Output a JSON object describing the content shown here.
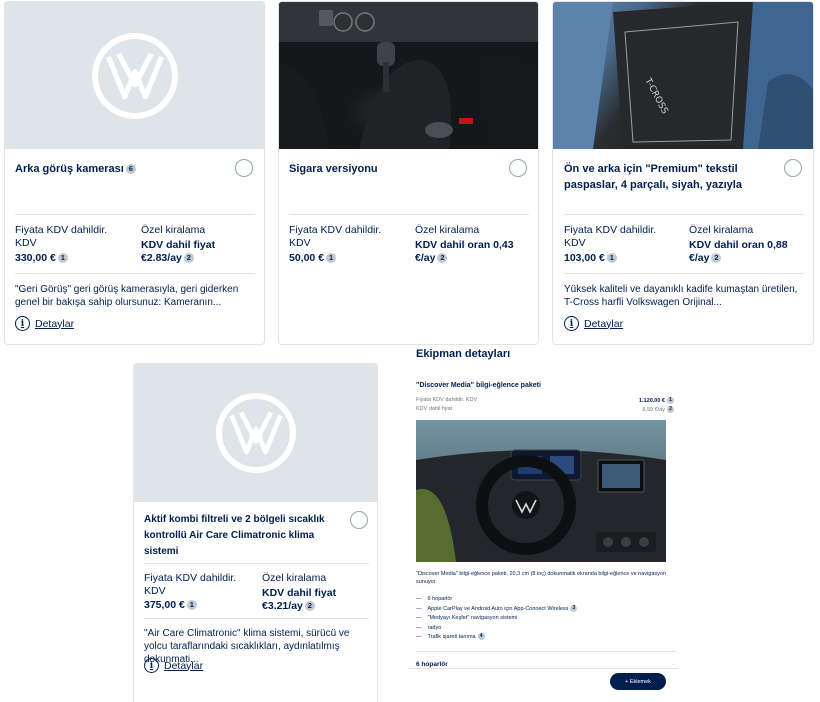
{
  "cards": [
    {
      "title": "Arka görüş kamerası",
      "title_fn": "6",
      "image": "vw-logo-placeholder",
      "price_label": "Fiyata KDV dahildir. KDV",
      "price_value": "330,00 €",
      "price_fn": "1",
      "lease_label": "Özel kiralama",
      "lease_value_1": "KDV dahil fiyat",
      "lease_value_2": "€2.83/ay",
      "lease_fn": "2",
      "description": "\"Geri Görüş\" geri görüş kamerasıyla, geri giderken genel bir bakışa sahip olursunuz: Kameranın...",
      "details_label": "Detaylar"
    },
    {
      "title": "Sigara versiyonu",
      "title_fn": "",
      "image": "interior-gear-photo",
      "price_label": "Fiyata KDV dahildir. KDV",
      "price_value": "50,00 €",
      "price_fn": "1",
      "lease_label": "Özel kiralama",
      "lease_value_1": "KDV dahil oran 0,43",
      "lease_value_2": "€/ay",
      "lease_fn": "2",
      "description": "",
      "details_label": ""
    },
    {
      "title": "Ön ve arka için \"Premium\" tekstil paspaslar, 4 parçalı, siyah, yazıyla",
      "title_fn": "",
      "image": "floor-mat-photo",
      "price_label": "Fiyata KDV dahildir. KDV",
      "price_value": "103,00 €",
      "price_fn": "1",
      "lease_label": "Özel kiralama",
      "lease_value_1": "KDV dahil oran 0,88",
      "lease_value_2": "€/ay",
      "lease_fn": "2",
      "description": "Yüksek kaliteli ve dayanıklı kadife kumaştan üretilen, T-Cross harfli Volkswagen Orijinal...",
      "details_label": "Detaylar"
    },
    {
      "title": "Aktif kombi filtreli ve 2 bölgeli sıcaklık kontrollü Air Care Climatronic klima sistemi",
      "title_fn": "",
      "image": "vw-logo-placeholder",
      "price_label": "Fiyata KDV dahildir. KDV",
      "price_value": "375,00 €",
      "price_fn": "1",
      "lease_label": "Özel kiralama",
      "lease_value_1": "KDV dahil fiyat",
      "lease_value_2": "€3.21/ay",
      "lease_fn": "2",
      "description": "\"Air Care Climatronic\" klima sistemi, sürücü ve yolcu taraflarındaki sıcaklıkları, aydınlatılmış dokunmati...",
      "details_label": "Detaylar"
    }
  ],
  "mat_text": "T-CROSS",
  "details_panel": {
    "heading": "Ekipman detayları",
    "item_title": "\"Discover Media\" bilgi-eğlence paketi",
    "price_label": "Fiyata KDV dahildir. KDV",
    "price_value": "1.120,00 €",
    "price_fn": "1",
    "lease_label": "KDV dahil fiyat",
    "lease_value": "9,59 €/ay",
    "lease_fn": "2",
    "caption": "\"Discover Media\" bilgi-eğlence paketi, 20,3 cm (8 inç) dokunmatik ekranda bilgi-eğlence ve navigasyon sunuyor.",
    "features": [
      "6 hoparlör",
      "Apple CarPlay ve Android Auto için App-Connect Wireless",
      "\"Medyayı Keşfet\" navigasyon sistemi",
      "radyo",
      "Trafik işareti tanıma"
    ],
    "feature_fns": [
      "",
      "3",
      "",
      "",
      "4"
    ],
    "sub_heading": "6 hoparlör",
    "add_button": "+ Eklemek"
  },
  "colors": {
    "brand": "#001e50",
    "placeholder": "#dfe4e8",
    "border": "#dfe4e8"
  }
}
